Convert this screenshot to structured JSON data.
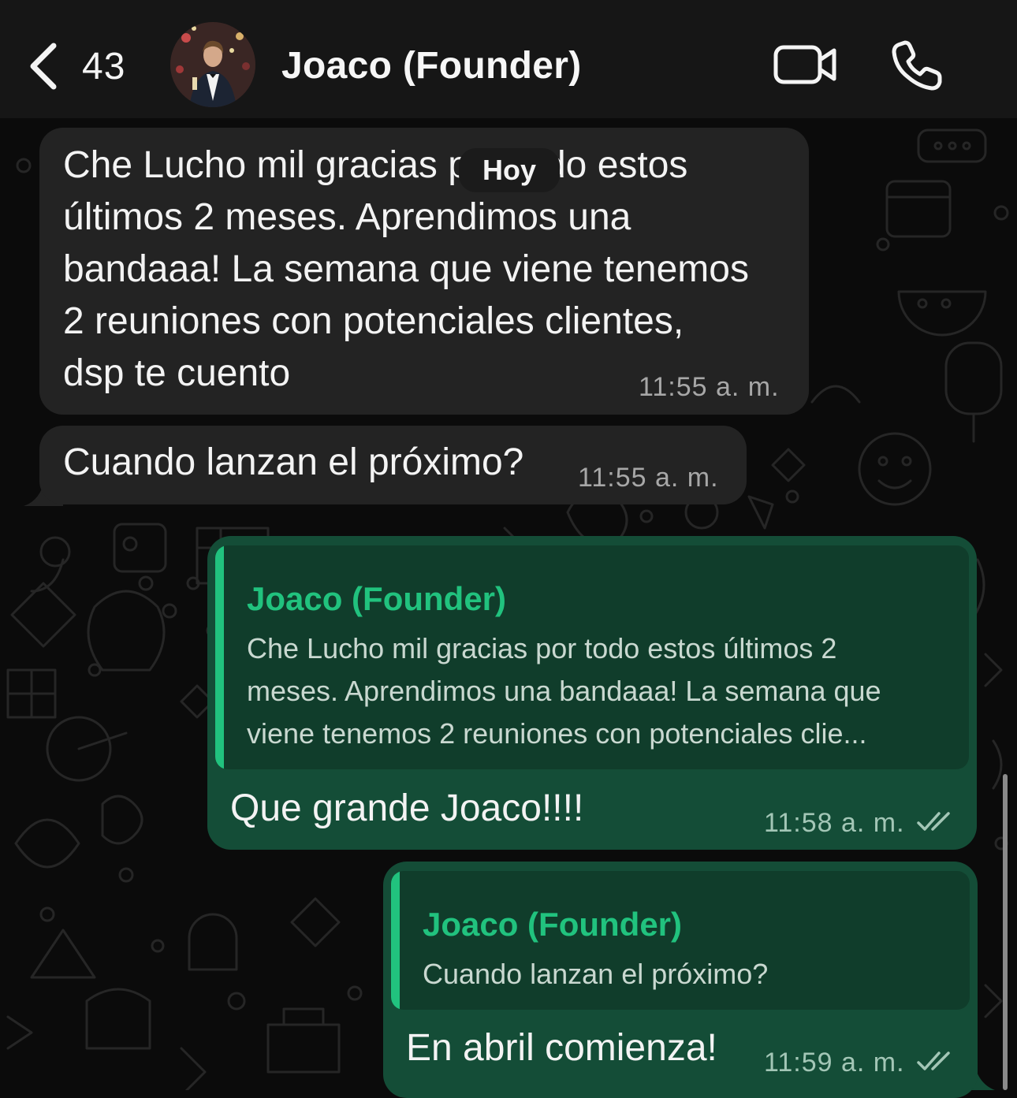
{
  "header": {
    "unread_count": "43",
    "contact_name": "Joaco (Founder)"
  },
  "date_separator": "Hoy",
  "messages": [
    {
      "direction": "incoming",
      "text": "Che Lucho mil gracias por todo estos\núltimos 2 meses. Aprendimos una\nbandaaa! La semana que viene tenemos\n2 reuniones con potenciales clientes,\ndsp te cuento",
      "time": "11:55 a. m."
    },
    {
      "direction": "incoming",
      "text": "Cuando lanzan el próximo?",
      "time": "11:55 a. m."
    },
    {
      "direction": "outgoing",
      "quote_author": "Joaco (Founder)",
      "quote_text": "Che Lucho mil gracias por todo estos últimos 2\nmeses. Aprendimos una bandaaa! La semana que\nviene tenemos 2 reuniones con potenciales clie...",
      "text": "Que grande Joaco!!!!",
      "time": "11:58 a. m.",
      "status": "read"
    },
    {
      "direction": "outgoing",
      "quote_author": "Joaco (Founder)",
      "quote_text": "Cuando lanzan el próximo?",
      "text": "En abril comienza!",
      "time": "11:59 a. m.",
      "status": "read"
    }
  ],
  "colors": {
    "incoming_bubble": "#232323",
    "outgoing_bubble": "#144d37",
    "quote_accent": "#21c27e",
    "background": "#0b0b0b"
  },
  "icons": [
    "back-chevron-icon",
    "video-call-icon",
    "voice-call-icon",
    "double-check-icon"
  ]
}
